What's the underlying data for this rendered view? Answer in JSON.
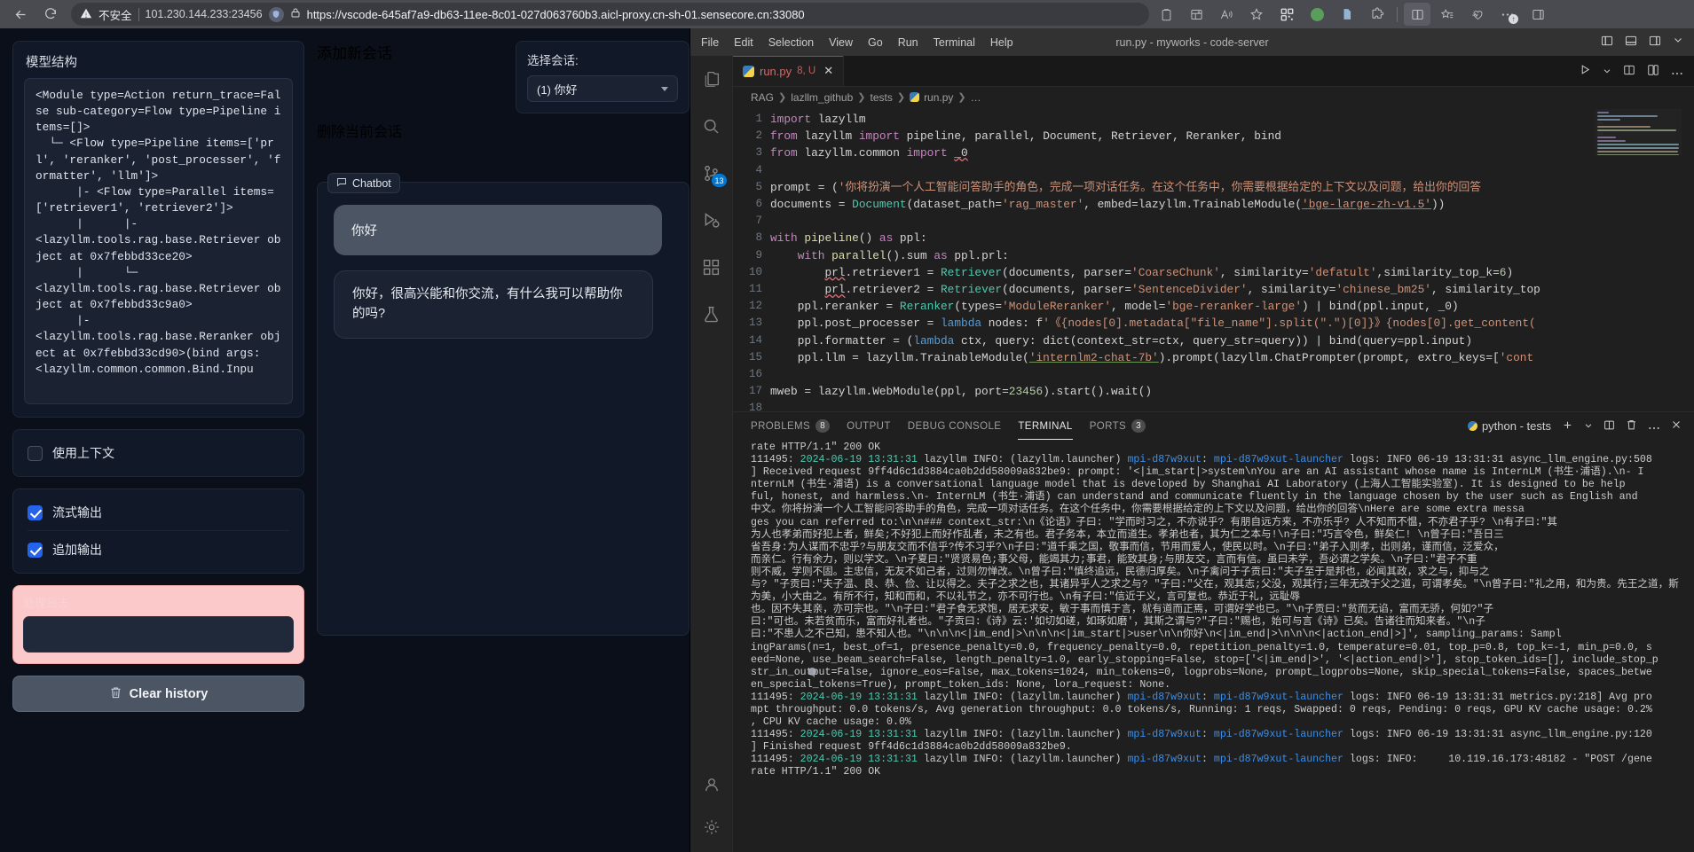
{
  "browser": {
    "back_icon": "back-arrow-icon",
    "reload_icon": "reload-icon",
    "warning_text": "不安全",
    "ip_text": "101.230.144.233:23456",
    "url": "https://vscode-645af7a9-db63-11ee-8c01-027d063760b3.aicl-proxy.cn-sh-01.sensecore.cn:33080",
    "toolbar_icons": [
      "clipboard-icon",
      "collections-icon",
      "read-aloud-icon",
      "favorite-star-icon",
      "qr-code-icon",
      "green-circle-icon",
      "document-icon",
      "extensions-icon",
      "split-screen-icon",
      "favorites-list-icon",
      "browser-essentials-icon",
      "more-options-icon",
      "sidebar-toggle-icon"
    ]
  },
  "gradio": {
    "model_struct_label": "模型结构",
    "model_struct_code": "<Module type=Action return_trace=False sub-category=Flow type=Pipeline items=[]>\n  └─ <Flow type=Pipeline items=['prl', 'reranker', 'post_processer', 'formatter', 'llm']>\n      |- <Flow type=Parallel items=['retriever1', 'retriever2']>\n      |      |-\n<lazyllm.tools.rag.base.Retriever object at 0x7febbd33ce20>\n      |      └─\n<lazyllm.tools.rag.base.Retriever object at 0x7febbd33c9a0>\n      |-\n<lazyllm.tools.rag.base.Reranker object at 0x7febbd33cd90>(bind args:\n<lazyllm.common.common.Bind.Inpu",
    "checkboxes": [
      {
        "label": "使用上下文",
        "checked": false
      },
      {
        "label": "流式输出",
        "checked": true
      },
      {
        "label": "追加输出",
        "checked": true
      }
    ],
    "log_label": "处理日志",
    "clear_history_label": "Clear history",
    "trash_icon": "trash-icon",
    "add_session_label": "添加新会话",
    "delete_session_label": "删除当前会话",
    "select_session_label": "选择会话:",
    "selected_session": "(1) 你好",
    "chatbot_label": "Chatbot",
    "chatbot_icon": "chat-bubble-icon",
    "messages": [
      {
        "role": "user",
        "text": "你好"
      },
      {
        "role": "bot",
        "text": "你好，很高兴能和你交流，有什么我可以帮助你的吗?"
      }
    ]
  },
  "vscode": {
    "menu": [
      "File",
      "Edit",
      "Selection",
      "View",
      "Go",
      "Run",
      "Terminal",
      "Help"
    ],
    "window_title": "run.py - myworks - code-server",
    "layout_icons": [
      "panel-left-icon",
      "panel-bottom-icon",
      "panel-right-icon",
      "customize-layout-icon"
    ],
    "activity_icons": [
      "explorer-icon",
      "search-icon",
      "source-control-icon",
      "run-debug-icon",
      "extensions-icon",
      "testing-icon",
      "accounts-icon",
      "settings-gear-icon"
    ],
    "source_control_badge": "13",
    "tab": {
      "filename": "run.py",
      "meta": "8, U",
      "close": "✕",
      "icon": "python-file-icon"
    },
    "tab_actions": [
      "run-play-icon",
      "chevron-down-icon",
      "split-editor-icon",
      "open-changes-icon",
      "more-actions-icon"
    ],
    "breadcrumb": [
      "RAG",
      "lazllm_github",
      "tests",
      "run.py",
      "…"
    ],
    "code_lines": [
      {
        "n": 1,
        "html": "<span class=\"k\">import</span> lazyllm"
      },
      {
        "n": 2,
        "html": "<span class=\"k\">from</span> lazyllm <span class=\"k\">import</span> pipeline, parallel, Document, Retriever, Reranker, bind"
      },
      {
        "n": 3,
        "html": "<span class=\"k\">from</span> lazyllm.common <span class=\"k\">import</span> <span class=\"sq\">_0</span>"
      },
      {
        "n": 4,
        "html": ""
      },
      {
        "n": 5,
        "html": "prompt = (<span class=\"s\">'你将扮演一个人工智能问答助手的角色，完成一项对话任务。在这个任务中，你需要根据给定的上下文以及问题，给出你的回答</span>"
      },
      {
        "n": 6,
        "html": "documents = <span class=\"cls\">Document</span>(dataset_path=<span class=\"s\">'rag_master'</span>, embed=lazyllm.TrainableModule(<span class=\"s\"><span class=\"und\">'bge-large-zh-v1.5'</span></span>))"
      },
      {
        "n": 7,
        "html": ""
      },
      {
        "n": 8,
        "html": "<span class=\"k\">with</span> <span class=\"fn\">pipeline</span>() <span class=\"k\">as</span> ppl:"
      },
      {
        "n": 9,
        "html": "    <span class=\"k\">with</span> <span class=\"fn\">parallel</span>().sum <span class=\"k\">as</span> ppl.prl:"
      },
      {
        "n": 10,
        "html": "        <span class=\"sq\">prl</span>.retriever1 = <span class=\"cls\">Retriever</span>(documents, parser=<span class=\"s\">'CoarseChunk'</span>, similarity=<span class=\"s\">'defatult'</span>,similarity_top_k=<span class=\"n\">6</span>)"
      },
      {
        "n": 11,
        "html": "        <span class=\"sq\">prl</span>.retriever2 = <span class=\"cls\">Retriever</span>(documents, parser=<span class=\"s\">'SentenceDivider'</span>, similarity=<span class=\"s\">'chinese_bm25'</span>, similarity_top"
      },
      {
        "n": 12,
        "html": "    ppl.reranker = <span class=\"cls\">Reranker</span>(types=<span class=\"s\">'ModuleReranker'</span>, model=<span class=\"s\">'bge-reranker-large'</span>) | bind(ppl.input, <span class=\"op\">_0</span>)"
      },
      {
        "n": 13,
        "html": "    ppl.post_processer = <span class=\"kb\">lambda</span> nodes: f<span class=\"s\">'《{nodes[0].metadata[\"file_name\"].split(\".\")[0]}》{nodes[0].get_content(</span>"
      },
      {
        "n": 14,
        "html": "    ppl.formatter = (<span class=\"kb\">lambda</span> ctx, query: dict(context_str=ctx, query_str=query)) | bind(query=ppl.input)"
      },
      {
        "n": 15,
        "html": "    ppl.llm = lazyllm.TrainableModule(<span class=\"s\"><span class=\"und\">'internlm2-chat-7b'</span></span>).prompt(lazyllm.ChatPrompter(prompt, extro_keys=[<span class=\"s\">'cont</span>"
      },
      {
        "n": 16,
        "html": ""
      },
      {
        "n": 17,
        "html": "mweb = lazyllm.WebModule(ppl, port=<span class=\"n\">23456</span>).start().wait()"
      },
      {
        "n": 18,
        "html": ""
      }
    ],
    "panel_tabs": [
      {
        "label": "PROBLEMS",
        "badge": "8",
        "active": false
      },
      {
        "label": "OUTPUT",
        "badge": "",
        "active": false
      },
      {
        "label": "DEBUG CONSOLE",
        "badge": "",
        "active": false
      },
      {
        "label": "TERMINAL",
        "badge": "",
        "active": true
      },
      {
        "label": "PORTS",
        "badge": "3",
        "active": false
      }
    ],
    "terminal_selector": "python - tests",
    "panel_actions": [
      "add-terminal-icon",
      "split-terminal-icon",
      "kill-terminal-icon",
      "more-actions-icon",
      "close-panel-icon"
    ],
    "terminal_text": "rate HTTP/1.1\" 200 OK\n111495: 2024-06-19 13:31:31 lazyllm INFO: (lazyllm.launcher) mpi-d87w9xut: mpi-d87w9xut-launcher logs: INFO 06-19 13:31:31 async_llm_engine.py:508\n] Received request 9ff4d6c1d3884ca0b2dd58009a832be9: prompt: '<|im_start|>system\\nYou are an AI assistant whose name is InternLM (书生·浦语).\\n- I\nnternLM (书生·浦语) is a conversational language model that is developed by Shanghai AI Laboratory (上海人工智能实验室). It is designed to be help\nful, honest, and harmless.\\n- InternLM (书生·浦语) can understand and communicate fluently in the language chosen by the user such as English and\n中文。你将扮演一个人工智能问答助手的角色，完成一项对话任务。在这个任务中，你需要根据给定的上下文以及问题，给出你的回答\\nHere are some extra messa\nges you can referred to:\\n\\n### context_str:\\n《论语》子曰: \"学而时习之，不亦说乎? 有朋自远方来，不亦乐乎? 人不知而不愠，不亦君子乎? \\n有子曰:\"其\n为人也孝弟而好犯上者，鲜矣;不好犯上而好作乱者，未之有也。君子务本，本立而道生。孝弟也者，其为仁之本与!\\n子曰:\"巧言令色，鲜矣仁! \\n曾子曰:\"吾日三\n省吾身:为人谋而不忠乎?与朋友交而不信乎?传不习乎?\\n子曰:\"道千乘之国，敬事而信，节用而爱人，使民以时。\\n子曰:\"弟子入则孝，出则弟，谨而信，泛爱众，\n而亲仁。行有余力，则以学文。\\n子夏曰:\"贤贤易色;事父母，能竭其力;事君，能致其身;与朋友交，言而有信。虽曰未学，吾必谓之学矣。\\n子曰:\"君子不重\n则不威，学则不固。主忠信，无友不如己者，过则勿惮改。\\n曾子曰:\"慎终追远，民德归厚矣。\\n子禽问于子贡曰:\"夫子至于是邦也，必闻其政，求之与，抑与之\n与? \"子贡曰:\"夫子温、良、恭、俭、让以得之。夫子之求之也，其诸异乎人之求之与? \"子曰:\"父在，观其志;父没，观其行;三年无改于父之道，可谓孝矣。\"\\n曾子曰:\"礼之用，和为贵。先王之道，斯为美，小大由之。有所不行，知和而和，不以礼节之，亦不可行也。\\n有子曰:\"信近于义，言可复也。恭近于礼，远耻辱\n也。因不失其亲，亦可宗也。\"\\n子曰:\"君子食无求饱，居无求安，敏于事而慎于言，就有道而正焉，可谓好学也已。\"\\n子贡曰:\"贫而无谄，富而无骄，何如?\"子\n曰:\"可也。未若贫而乐，富而好礼者也。\"子贡曰:《诗》云:'如切如磋，如琢如磨'，其斯之谓与?\"子曰:\"赐也，始可与言《诗》已矣。告诸往而知来者。\"\\n子\n曰:\"不患人之不己知，患不知人也。\"\\n\\n\\n<|im_end|>\\n\\n\\n<|im_start|>user\\n\\n你好\\n<|im_end|>\\n\\n\\n<|action_end|>]', sampling_params: Sampl\ningParams(n=1, best_of=1, presence_penalty=0.0, frequency_penalty=0.0, repetition_penalty=1.0, temperature=0.01, top_p=0.8, top_k=-1, min_p=0.0, s\need=None, use_beam_search=False, length_penalty=1.0, early_stopping=False, stop=['<|im_end|>', '<|action_end|>'], stop_token_ids=[], include_stop_p\nstr_in_output=False, ignore_eos=False, max_tokens=1024, min_tokens=0, logprobs=None, prompt_logprobs=None, skip_special_tokens=False, spaces_betwe\nen_special_tokens=True), prompt_token_ids: None, lora_request: None.\n111495: 2024-06-19 13:31:31 lazyllm INFO: (lazyllm.launcher) mpi-d87w9xut: mpi-d87w9xut-launcher logs: INFO 06-19 13:31:31 metrics.py:218] Avg pro\nmpt throughput: 0.0 tokens/s, Avg generation throughput: 0.0 tokens/s, Running: 1 reqs, Swapped: 0 reqs, Pending: 0 reqs, GPU KV cache usage: 0.2%\n, CPU KV cache usage: 0.0%\n111495: 2024-06-19 13:31:31 lazyllm INFO: (lazyllm.launcher) mpi-d87w9xut: mpi-d87w9xut-launcher logs: INFO 06-19 13:31:31 async_llm_engine.py:120\n] Finished request 9ff4d6c1d3884ca0b2dd58009a832be9.\n111495: 2024-06-19 13:31:31 lazyllm INFO: (lazyllm.launcher) mpi-d87w9xut: mpi-d87w9xut-launcher logs: INFO:     10.119.16.173:48182 - \"POST /gene\nrate HTTP/1.1\" 200 OK"
  }
}
